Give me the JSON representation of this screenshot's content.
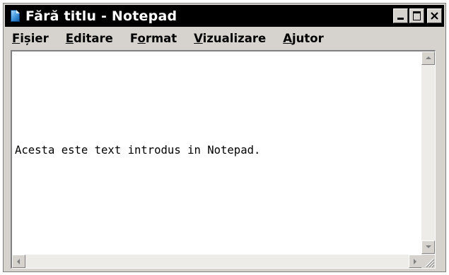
{
  "window": {
    "title": "Fără titlu - Notepad",
    "icon": "notepad-icon"
  },
  "titlebar_buttons": {
    "minimize_icon": "minimize-icon",
    "maximize_icon": "maximize-icon",
    "close_icon": "close-icon"
  },
  "menu": {
    "items": [
      {
        "hotkey": "F",
        "rest": "ișier"
      },
      {
        "hotkey": "E",
        "rest": "ditare"
      },
      {
        "pre": "F",
        "hotkey": "o",
        "rest": "rmat"
      },
      {
        "hotkey": "V",
        "rest": "izualizare"
      },
      {
        "hotkey": "A",
        "rest": "jutor"
      }
    ]
  },
  "editor": {
    "text": "Acesta este text introdus in Notepad."
  },
  "colors": {
    "titlebar": "#000000",
    "chrome": "#d6d3ce",
    "editor_bg": "#ffffff"
  }
}
